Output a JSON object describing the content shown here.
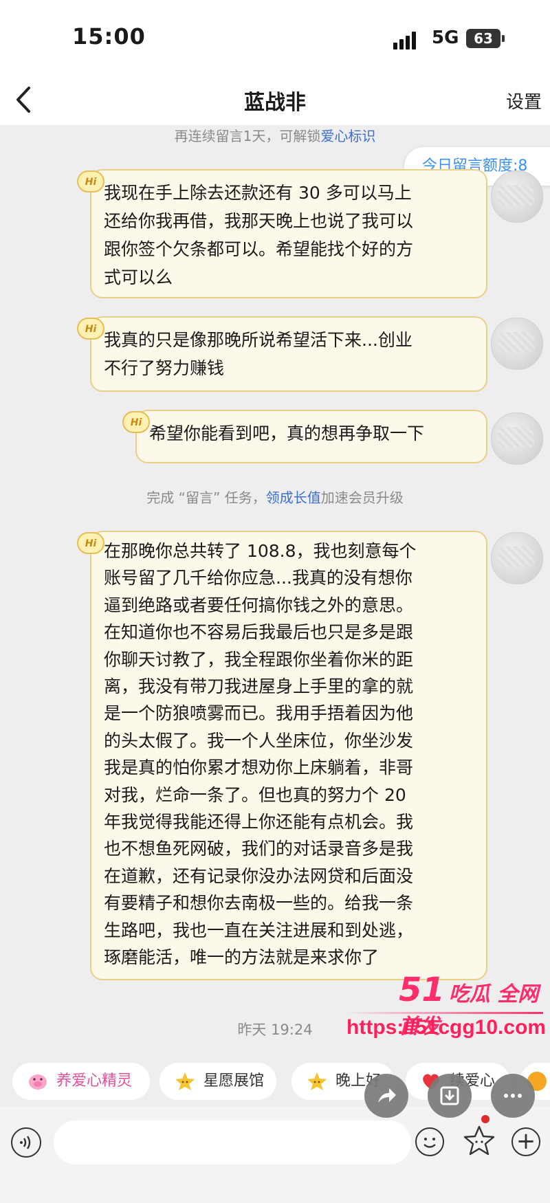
{
  "status_bar": {
    "time": "15:00",
    "network": "5G",
    "battery": "63"
  },
  "nav": {
    "title": "蓝战非",
    "settings_label": "设置"
  },
  "notices": {
    "streak_prefix": "再连续留言1天，可解锁",
    "streak_highlight": "爱心标识",
    "task_prefix": "完成 “留言” 任务，",
    "task_highlight": "领成长值",
    "task_suffix": "加速会员升级"
  },
  "quota_label": "今日留言额度:8",
  "badge_text": "Hi",
  "messages": [
    {
      "lines": [
        "我现在手上除去还款还有 30 多可以马上",
        "还给你我再借，我那天晚上也说了我可以",
        "跟你签个欠条都可以。希望能找个好的方",
        "式可以么"
      ]
    },
    {
      "lines": [
        "我真的只是像那晚所说希望活下来...创业",
        "不行了努力赚钱"
      ]
    },
    {
      "lines": [
        "希望你能看到吧，真的想再争取一下"
      ]
    },
    {
      "lines": [
        "在那晚你总共转了 108.8，我也刻意每个",
        "账号留了几千给你应急...我真的没有想你",
        "逼到绝路或者要任何搞你钱之外的意思。",
        "在知道你也不容易后我最后也只是多是跟",
        "你聊天讨教了，我全程跟你坐着你米的距",
        "离，我没有带刀我进屋身上手里的拿的就",
        "是一个防狼喷雾而已。我用手捂着因为他",
        "的头太假了。我一个人坐床位，你坐沙发",
        "我是真的怕你累才想劝你上床躺着，非哥",
        "对我，烂命一条了。但也真的努力个 20",
        "年我觉得我能还得上你还能有点机会。我",
        "也不想鱼死网破，我们的对话录音多是我",
        "在道歉，还有记录你没办法网贷和后面没",
        "有要精子和想你去南极一些的。给我一条",
        "生路吧，我也一直在关注进展和到处逃，",
        "琢磨能活，唯一的方法就是来求你了"
      ]
    }
  ],
  "timestamp": "昨天 19:24",
  "watermark": {
    "brand_number": "51",
    "brand_text": "吃瓜 全网首发",
    "url": "https://51cgg10.com"
  },
  "quick_actions": [
    "养爱心精灵",
    "星愿展馆",
    "晚上好",
    "续爱心"
  ],
  "colors": {
    "bubble_bg": "#fdf9ea",
    "bubble_border": "#e9cf86",
    "link_blue": "#3b6fd1",
    "watermark_pink": "#ff2e6a"
  }
}
